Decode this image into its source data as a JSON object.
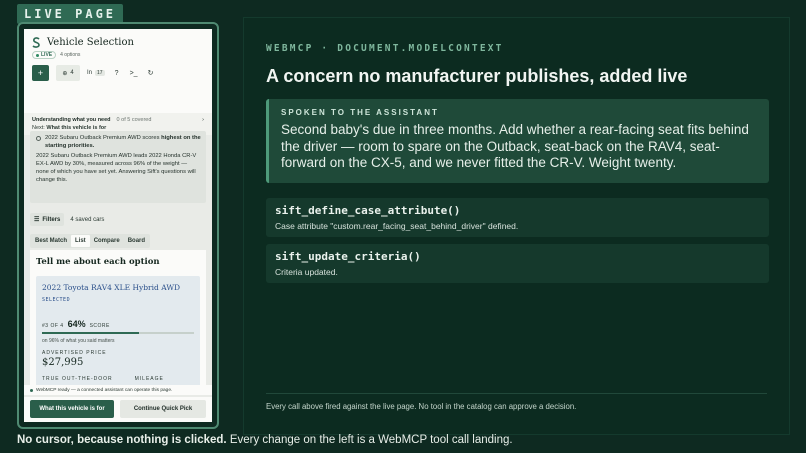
{
  "badge": {
    "label": "LIVE PAGE"
  },
  "app": {
    "title": "Vehicle Selection",
    "live_label": "LIVE",
    "options_count": "4 options",
    "toolbar": {
      "plus_label": "+",
      "zoom_count": "4",
      "inbox_label": "In",
      "inbox_count": "17"
    },
    "understanding": {
      "title": "Understanding what you need",
      "coverage": "0 of 5 covered",
      "next_label": "Next:",
      "next_value": "What this vehicle is for"
    },
    "message": {
      "line1_lead": "2022 Subaru Outback Premium AWD scores",
      "line1_bold": "highest on the starting priorities.",
      "body": "2022 Subaru Outback Premium AWD leads 2022 Honda CR-V EX-L AWD by 30%, measured across 96% of the weight — none of which you have set yet. Answering Sift's questions will change this."
    },
    "filters": {
      "label": "Filters",
      "saved": "4 saved cars"
    },
    "tabs": [
      {
        "label": "Best Match",
        "active": false
      },
      {
        "label": "List",
        "active": true
      },
      {
        "label": "Compare",
        "active": false
      },
      {
        "label": "Board",
        "active": false
      }
    ],
    "detail": {
      "title": "Tell me about each option",
      "car_name": "2022 Toyota RAV4 XLE Hybrid AWD",
      "selected_label": "SELECTED",
      "rank": "#3 OF 4",
      "score": "64%",
      "score_label": "SCORE",
      "score_fraction": 0.64,
      "matters": "on 96% of what you said matters",
      "advertised_label": "ADVERTISED PRICE",
      "price": "$27,995",
      "oot_label": "TRUE OUT-THE-DOOR",
      "mileage_label": "MILEAGE"
    },
    "footer_note": "WebMCP ready — a connected assistant can operate this page.",
    "buttons": {
      "primary": "What this vehicle is for",
      "secondary": "Continue Quick Pick"
    }
  },
  "panel": {
    "eyebrow": "WEBMCP · DOCUMENT.MODELCONTEXT",
    "headline": "A concern no manufacturer publishes, added live",
    "spoken_label": "SPOKEN TO THE ASSISTANT",
    "spoken_text": "Second baby's due in three months. Add whether a rear-facing seat fits behind the driver — room to spare on the Outback, seat-back on the RAV4, seat-forward on the CX-5, and we never fitted the CR-V. Weight twenty.",
    "calls": [
      {
        "name": "sift_define_case_attribute()",
        "desc": "Case attribute \"custom.rear_facing_seat_behind_driver\" defined."
      },
      {
        "name": "sift_update_criteria()",
        "desc": "Criteria updated."
      }
    ],
    "footer": "Every call above fired against the live page. No tool in the catalog can approve a decision."
  },
  "caption": {
    "bold": "No cursor, because nothing is clicked.",
    "rest": " Every change on the left is a WebMCP tool call landing."
  },
  "colors": {
    "background": "#0e2a21",
    "accent": "#2f6a54",
    "panel": "#0c2b20"
  }
}
